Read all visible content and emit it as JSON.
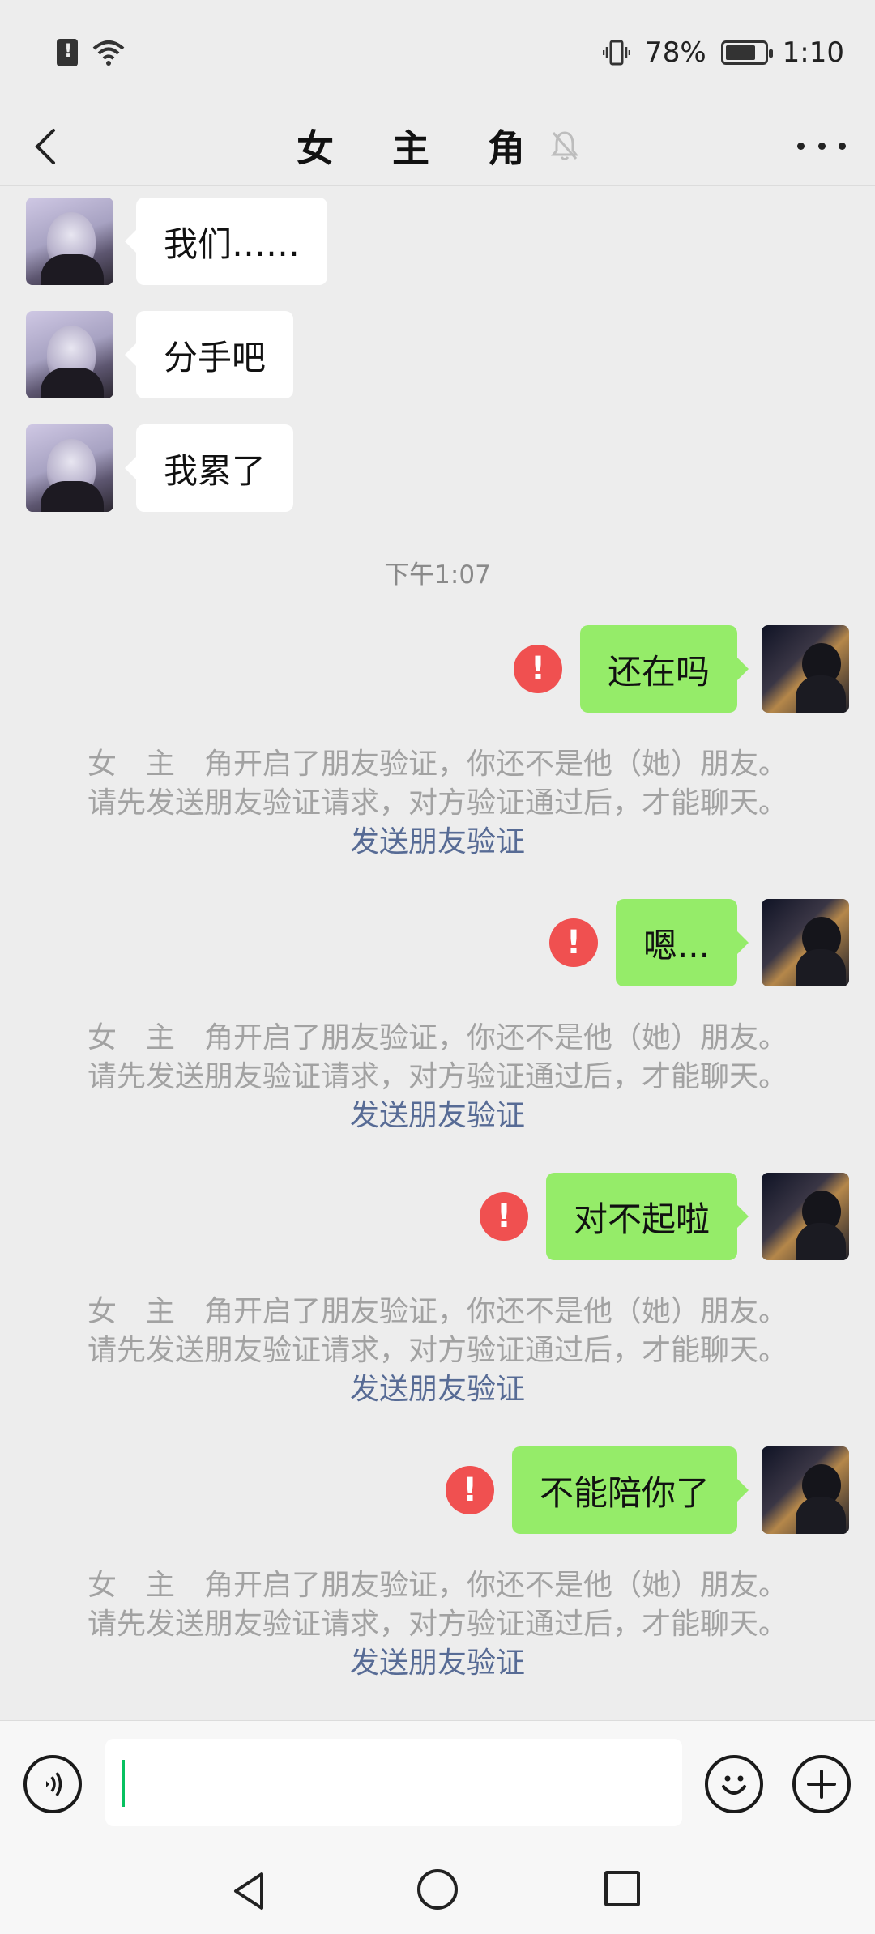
{
  "status_bar": {
    "battery_percent": "78%",
    "time": "1:10",
    "battery_level": 0.78
  },
  "header": {
    "title": "女 主 角"
  },
  "messages": [
    {
      "side": "in",
      "text": "我们……"
    },
    {
      "side": "in",
      "text": "分手吧"
    },
    {
      "side": "in",
      "text": "我累了"
    },
    {
      "side": "out",
      "text": "还在吗"
    },
    {
      "side": "out",
      "text": "嗯..."
    },
    {
      "side": "out",
      "text": "对不起啦"
    },
    {
      "side": "out",
      "text": "不能陪你了"
    }
  ],
  "timestamp": "下午1:07",
  "system_notice": {
    "line1": "女　主　角开启了朋友验证，你还不是他（她）朋友。",
    "line2": "请先发送朋友验证请求，对方验证通过后，才能聊天。",
    "link": "发送朋友验证"
  },
  "error_mark": "!",
  "colors": {
    "background": "#ededed",
    "outgoing_bubble": "#95ec69",
    "incoming_bubble": "#ffffff",
    "error": "#f05050",
    "link": "#576b95",
    "caret": "#07c160"
  }
}
